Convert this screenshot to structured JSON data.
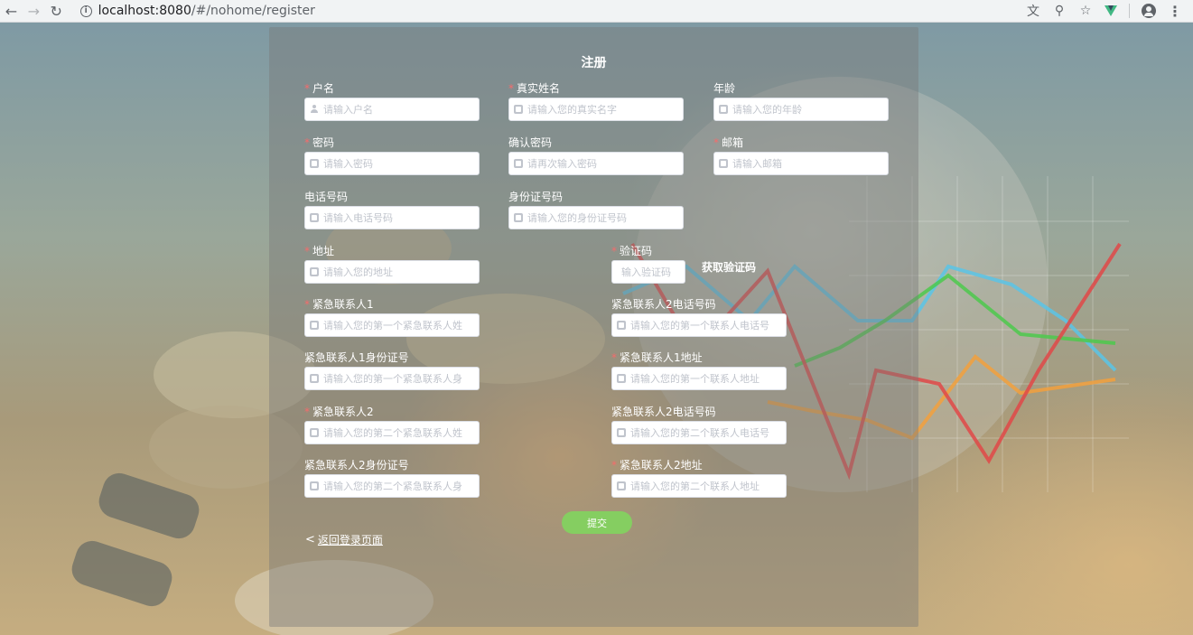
{
  "browser": {
    "url_host": "localhost:8080",
    "url_path": "/#/nohome/register",
    "icons": [
      "back-arrow-icon",
      "forward-arrow-icon",
      "reload-icon",
      "info-icon",
      "translate-icon",
      "zoom-icon",
      "star-icon",
      "vue-devtools-icon",
      "account-icon",
      "menu-icon"
    ]
  },
  "form": {
    "title": "注册",
    "fields": {
      "username": {
        "label": "户名",
        "placeholder": "请输入户名",
        "required": true
      },
      "realname": {
        "label": "真实姓名",
        "placeholder": "请输入您的真实名字",
        "required": true
      },
      "age": {
        "label": "年龄",
        "placeholder": "请输入您的年龄",
        "required": false
      },
      "password": {
        "label": "密码",
        "placeholder": "请输入密码",
        "required": true
      },
      "confirm": {
        "label": "确认密码",
        "placeholder": "请再次输入密码",
        "required": false
      },
      "email": {
        "label": "邮箱",
        "placeholder": "请输入邮箱",
        "required": true
      },
      "phone": {
        "label": "电话号码",
        "placeholder": "请输入电话号码",
        "required": false
      },
      "idcard": {
        "label": "身份证号码",
        "placeholder": "请输入您的身份证号码",
        "required": false
      },
      "address": {
        "label": "地址",
        "placeholder": "请输入您的地址",
        "required": true
      },
      "captcha": {
        "label": "验证码",
        "placeholder": "输入验证码",
        "required": true
      },
      "ec1_name": {
        "label": "紧急联系人1",
        "placeholder": "请输入您的第一个紧急联系人姓",
        "required": true
      },
      "ec1_phone": {
        "label": "紧急联系人2电话号码",
        "placeholder": "请输入您的第一个联系人电话号",
        "required": false
      },
      "ec1_id": {
        "label": "紧急联系人1身份证号",
        "placeholder": "请输入您的第一个紧急联系人身",
        "required": false
      },
      "ec1_addr": {
        "label": "紧急联系人1地址",
        "placeholder": "请输入您的第一个联系人地址",
        "required": true
      },
      "ec2_name": {
        "label": "紧急联系人2",
        "placeholder": "请输入您的第二个紧急联系人姓",
        "required": true
      },
      "ec2_phone": {
        "label": "紧急联系人2电话号码",
        "placeholder": "请输入您的第二个联系人电话号",
        "required": false
      },
      "ec2_id": {
        "label": "紧急联系人2身份证号",
        "placeholder": "请输入您的第二个紧急联系人身",
        "required": false
      },
      "ec2_addr": {
        "label": "紧急联系人2地址",
        "placeholder": "请输入您的第二个联系人地址",
        "required": true
      }
    },
    "required_mark": "*",
    "get_code_label": "获取验证码",
    "submit_label": "提交",
    "back_label": "返回登录页面",
    "back_chevron": "<"
  },
  "colors": {
    "submit": "#85ce61",
    "required_star": "#f56c6c",
    "panel": "rgba(120,120,120,0.42)"
  }
}
